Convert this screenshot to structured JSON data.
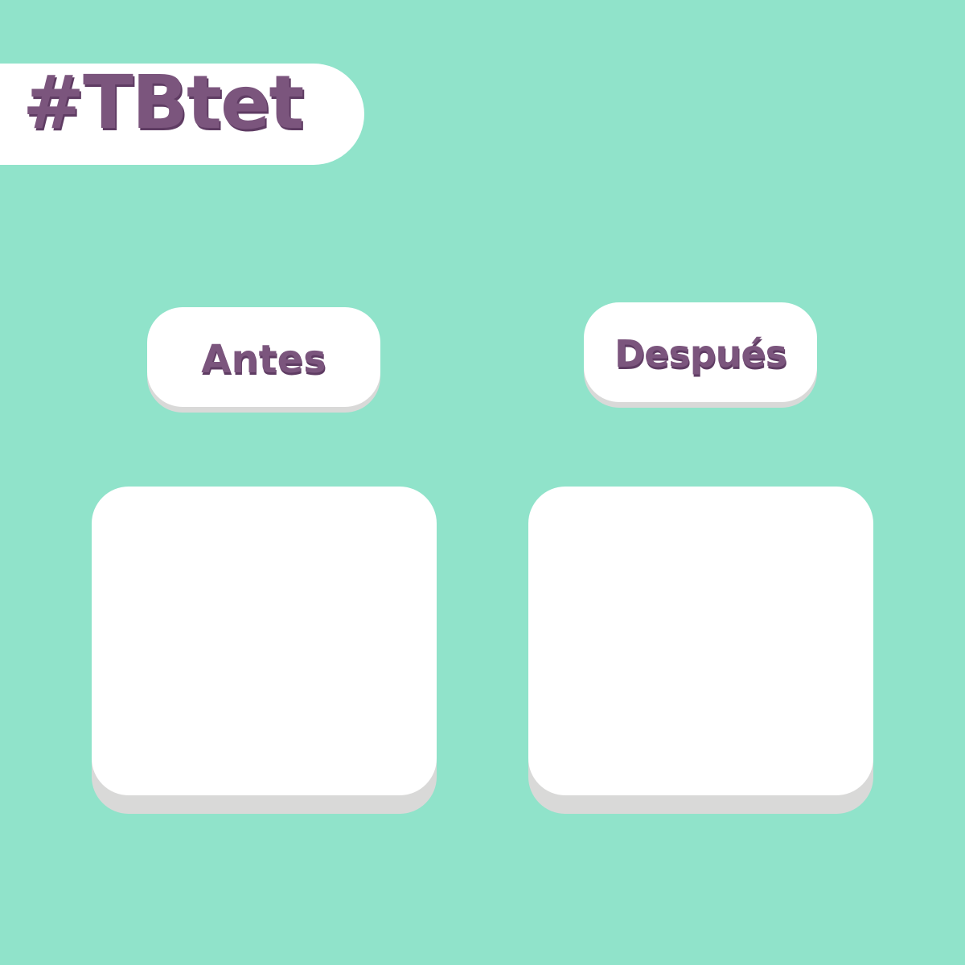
{
  "header": {
    "hashtag": "#TBtet"
  },
  "labels": {
    "before": "Antes",
    "after": "Después"
  },
  "colors": {
    "background": "#90e3ca",
    "text": "#7b557d",
    "text_shadow": "#5f3c63",
    "card": "#ffffff",
    "card_shadow": "#d9d9d8"
  }
}
